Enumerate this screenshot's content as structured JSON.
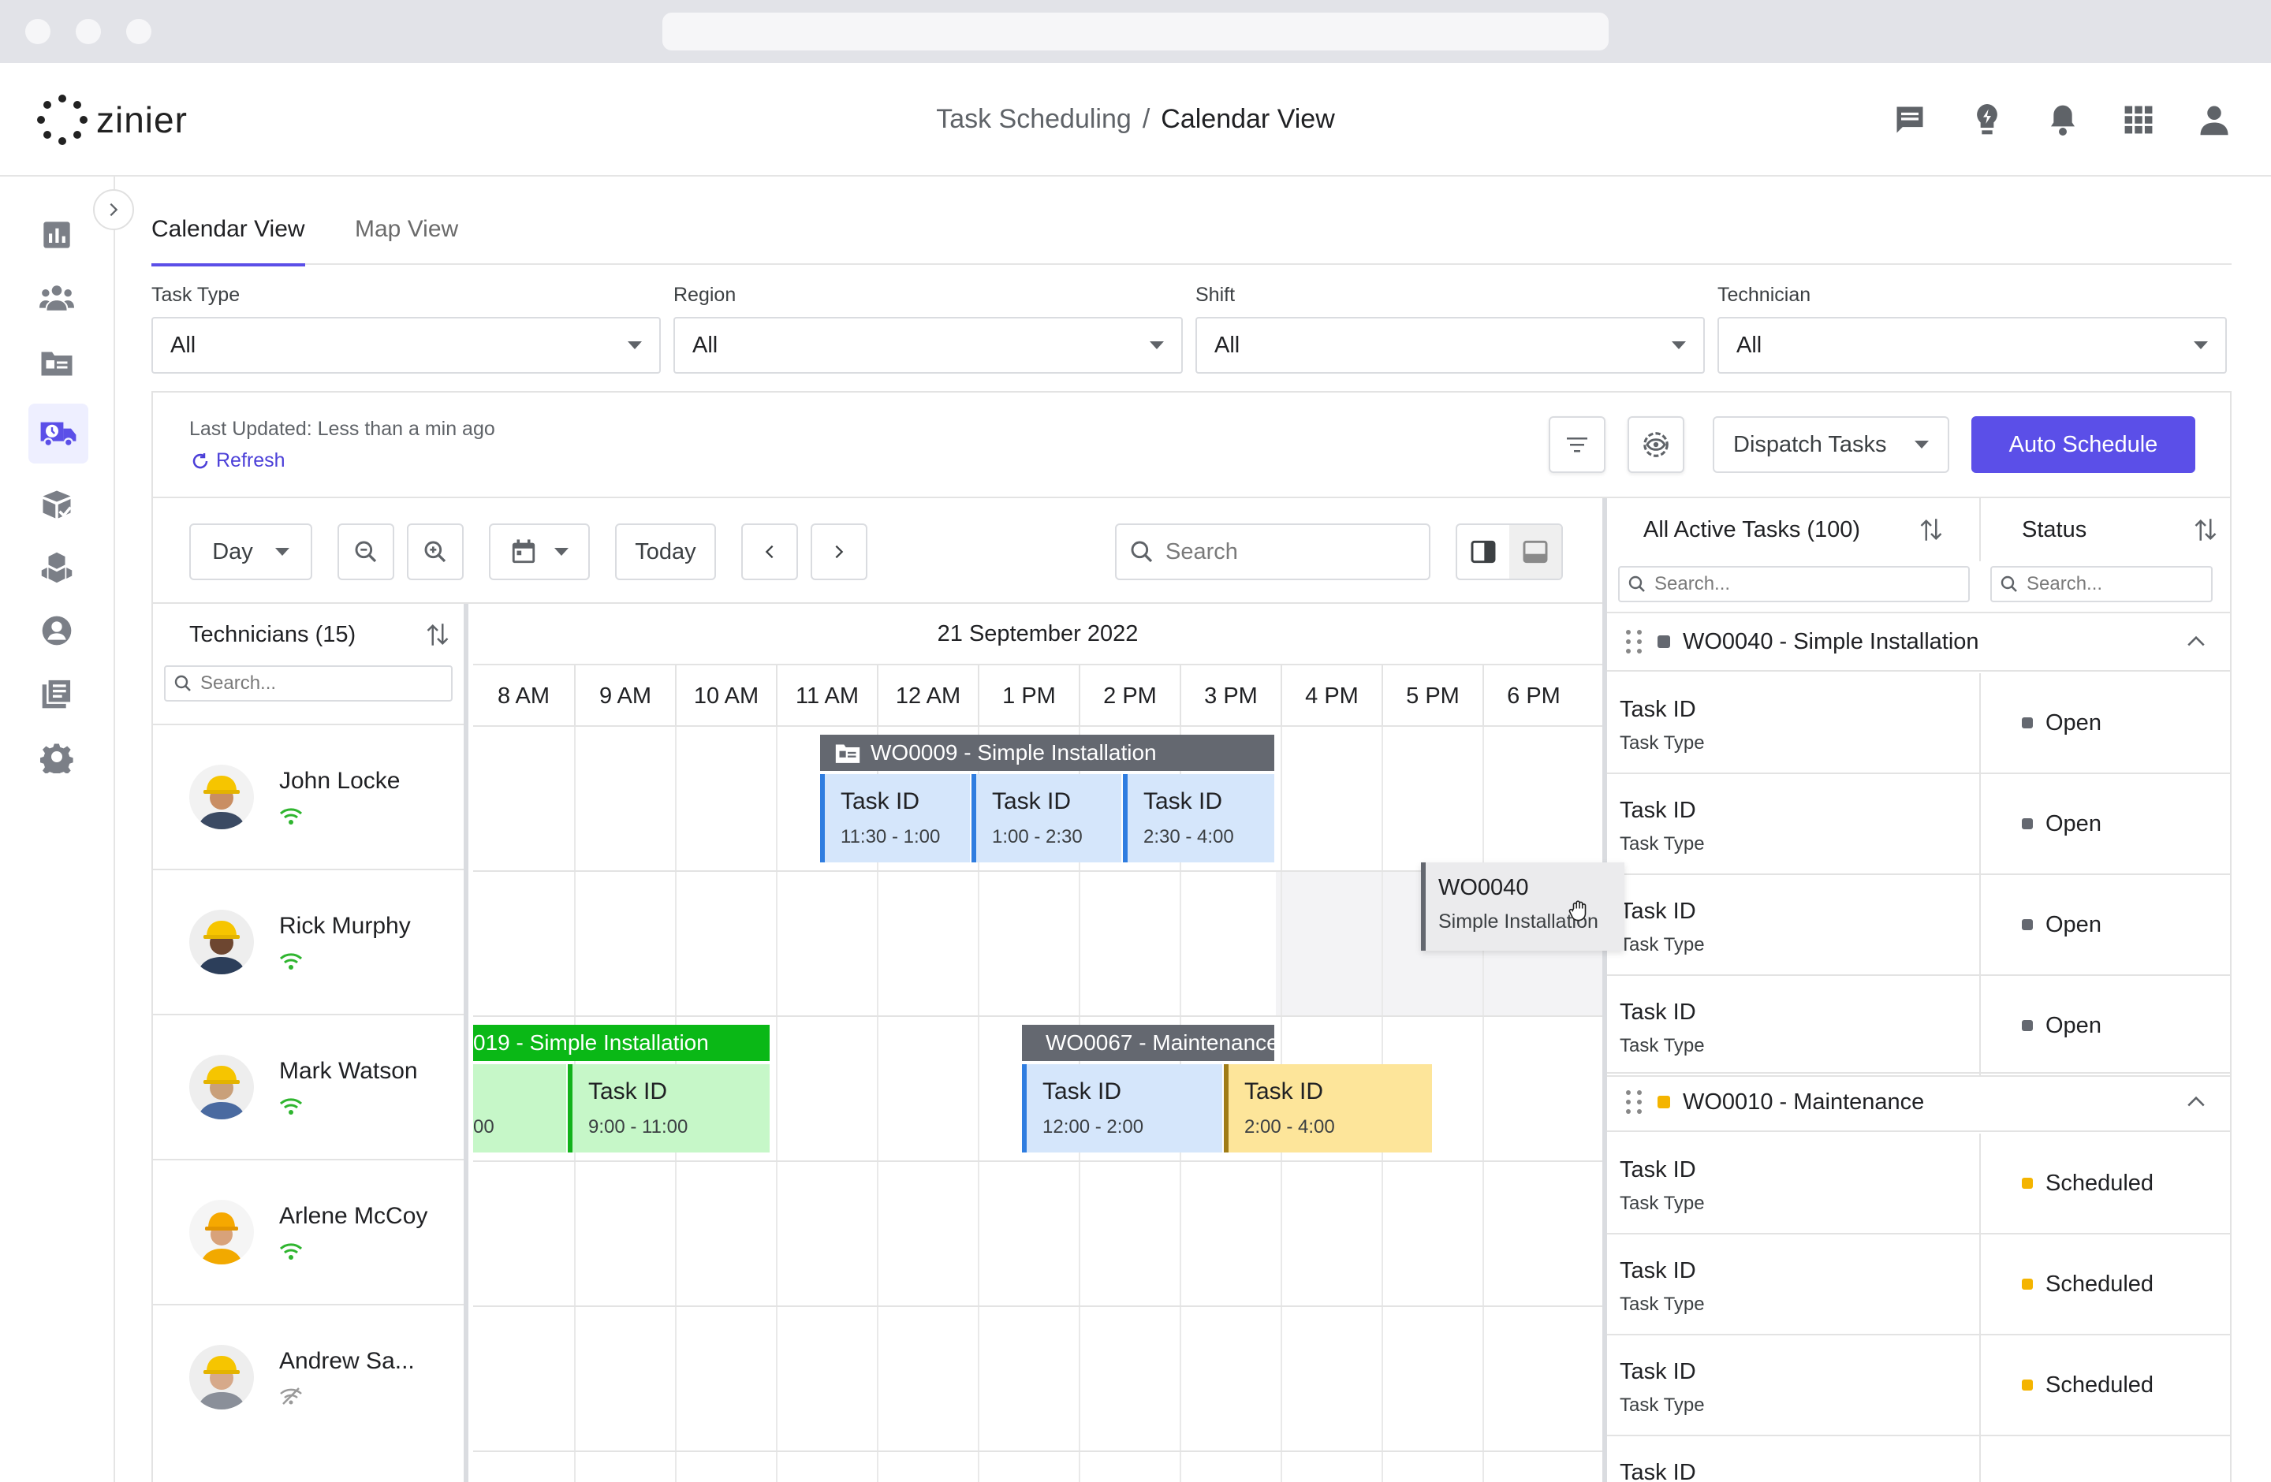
{
  "browser": {
    "url": ""
  },
  "app": {
    "logo_text": "zinier",
    "breadcrumb": {
      "parent": "Task Scheduling",
      "separator": "/",
      "current": "Calendar View"
    }
  },
  "sidebar": {
    "items": [
      "dashboard-icon",
      "team-icon",
      "work-orders-icon",
      "dispatch-icon",
      "inventory-icon",
      "assets-icon",
      "users-icon",
      "reports-icon",
      "settings-icon"
    ],
    "active_index": 3
  },
  "tabs": [
    {
      "label": "Calendar View",
      "active": true
    },
    {
      "label": "Map View",
      "active": false
    }
  ],
  "filters": [
    {
      "label": "Task Type",
      "value": "All"
    },
    {
      "label": "Region",
      "value": "All"
    },
    {
      "label": "Shift",
      "value": "All"
    },
    {
      "label": "Technician",
      "value": "All"
    }
  ],
  "status_bar": {
    "last_updated": "Last Updated: Less than a min ago",
    "refresh_label": "Refresh",
    "dispatch_label": "Dispatch Tasks",
    "auto_schedule_label": "Auto Schedule"
  },
  "calendar_toolbar": {
    "view": "Day",
    "today_label": "Today",
    "search_placeholder": "Search"
  },
  "technicians": {
    "header": "Technicians (15)",
    "search_placeholder": "Search...",
    "list": [
      {
        "name": "John Locke",
        "online": true
      },
      {
        "name": "Rick Murphy",
        "online": true
      },
      {
        "name": "Mark Watson",
        "online": true
      },
      {
        "name": "Arlene McCoy",
        "online": true
      },
      {
        "name": "Andrew Sa...",
        "online": false
      }
    ]
  },
  "calendar": {
    "date": "21 September 2022",
    "hours": [
      "8 AM",
      "9 AM",
      "10 AM",
      "11 AM",
      "12 AM",
      "1 PM",
      "2 PM",
      "3 PM",
      "4 PM",
      "5 PM",
      "6 PM"
    ],
    "work_orders": [
      {
        "title": "WO0009 - Simple Installation",
        "color": "#646870",
        "tasks": [
          {
            "id": "Task ID",
            "time": "11:30 - 1:00"
          },
          {
            "id": "Task ID",
            "time": "1:00 - 2:30"
          },
          {
            "id": "Task ID",
            "time": "2:30 - 4:00"
          }
        ]
      },
      {
        "title": "019 - Simple Installation",
        "color": "#0ab816",
        "tasks": [
          {
            "id": "",
            "time": "00"
          },
          {
            "id": "Task ID",
            "time": "9:00 - 11:00"
          }
        ]
      },
      {
        "title": "WO0067 - Maintenance",
        "color": "#646870",
        "tasks": [
          {
            "id": "Task ID",
            "time": "12:00 - 2:00"
          },
          {
            "id": "Task ID",
            "time": "2:00 - 4:00"
          }
        ]
      }
    ],
    "dragging": {
      "id": "WO0040",
      "type": "Simple Installation"
    }
  },
  "tasks_panel": {
    "header": "All Active Tasks (100)",
    "status_header": "Status",
    "search_placeholder": "Search...",
    "status_search_placeholder": "Search...",
    "groups": [
      {
        "title": "WO0040 - Simple Installation",
        "color": "#646870",
        "rows": [
          {
            "id": "Task ID",
            "type": "Task Type",
            "status": "Open",
            "status_color": "#646870"
          },
          {
            "id": "Task ID",
            "type": "Task Type",
            "status": "Open",
            "status_color": "#646870"
          },
          {
            "id": "Task ID",
            "type": "Task Type",
            "status": "Open",
            "status_color": "#646870"
          },
          {
            "id": "Task ID",
            "type": "Task Type",
            "status": "Open",
            "status_color": "#646870"
          }
        ]
      },
      {
        "title": "WO0010 - Maintenance",
        "color": "#f4b400",
        "rows": [
          {
            "id": "Task ID",
            "type": "Task Type",
            "status": "Scheduled",
            "status_color": "#f4b400"
          },
          {
            "id": "Task ID",
            "type": "Task Type",
            "status": "Scheduled",
            "status_color": "#f4b400"
          },
          {
            "id": "Task ID",
            "type": "Task Type",
            "status": "Scheduled",
            "status_color": "#f4b400"
          },
          {
            "id": "Task ID",
            "type": "",
            "status": "",
            "status_color": "#f4b400"
          }
        ]
      }
    ]
  },
  "colors": {
    "accent": "#5b4fe8",
    "online": "#2fb52f"
  }
}
